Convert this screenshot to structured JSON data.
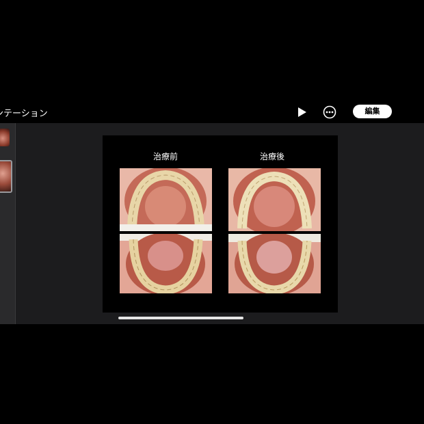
{
  "header": {
    "title": "ンテーション",
    "edit_label": "編集",
    "play_icon": "play-icon",
    "more_icon": "ellipsis-circle-icon"
  },
  "slide": {
    "label_before": "治療前",
    "label_after": "治療後"
  },
  "colors": {
    "background": "#000000",
    "app_surface": "#1c1c1e",
    "sidebar": "#2a2a2c",
    "button": "#ffffff"
  }
}
